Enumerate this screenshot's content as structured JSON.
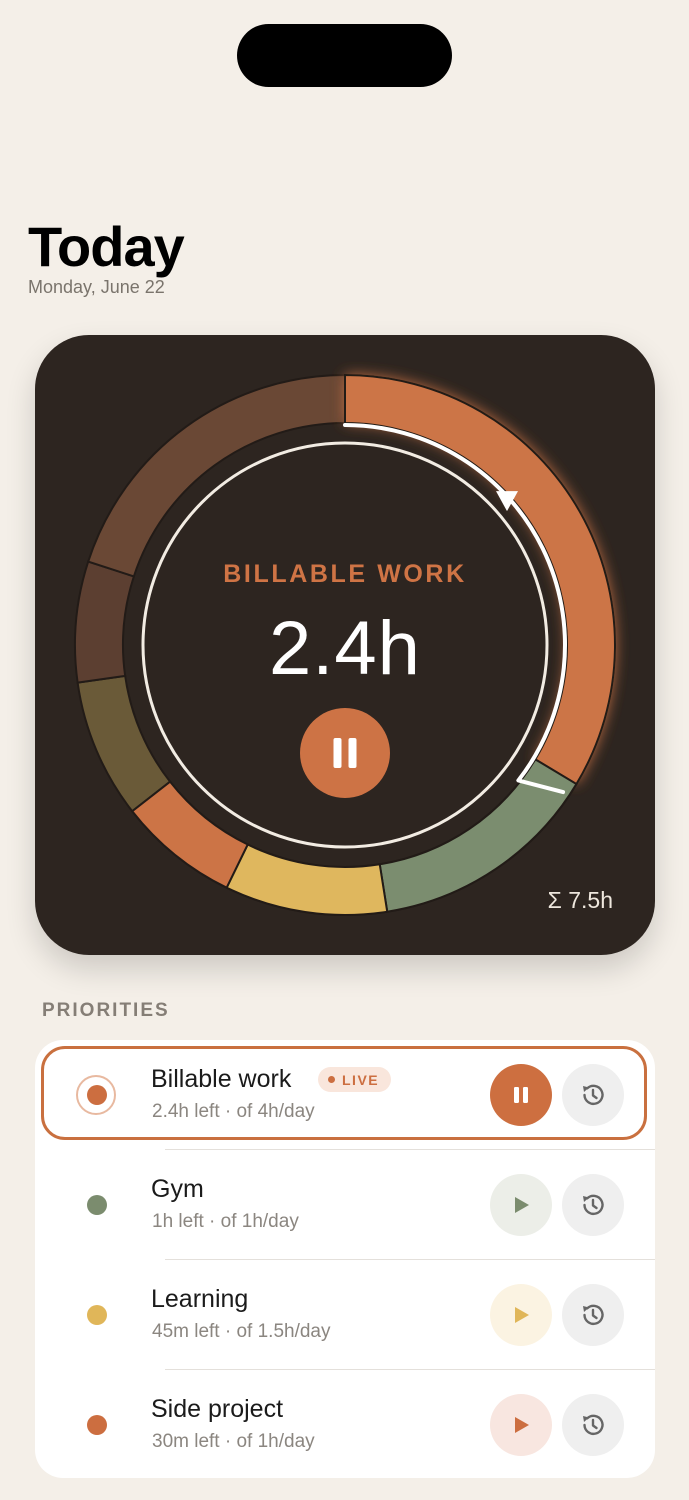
{
  "header": {
    "title": "Today",
    "date": "Monday, June 22"
  },
  "dial": {
    "active_label": "BILLABLE WORK",
    "active_value": "2.4h",
    "total": "Σ 7.5h",
    "segments": [
      {
        "name": "Billable work",
        "color": "#cc7446"
      },
      {
        "name": "Gym",
        "color": "#7b8d6f"
      },
      {
        "name": "Learning",
        "color": "#dfb75e"
      },
      {
        "name": "Side project",
        "color": "#cc7446"
      }
    ]
  },
  "priorities": {
    "title": "PRIORITIES",
    "items": [
      {
        "name": "Billable work",
        "badge": "LIVE",
        "subtitle": "2.4h left · of 4h/day",
        "color": "#cc6e40",
        "action": "pause-icon",
        "active": true
      },
      {
        "name": "Gym",
        "subtitle": "1h left · of 1h/day",
        "color": "#7b8c6e",
        "action": "play-icon",
        "active": false
      },
      {
        "name": "Learning",
        "subtitle": "45m left · of 1.5h/day",
        "color": "#e0b659",
        "action": "play-icon",
        "active": false
      },
      {
        "name": "Side project",
        "subtitle": "30m left · of 1h/day",
        "color": "#cc6e40",
        "action": "play-icon",
        "active": false
      }
    ]
  }
}
